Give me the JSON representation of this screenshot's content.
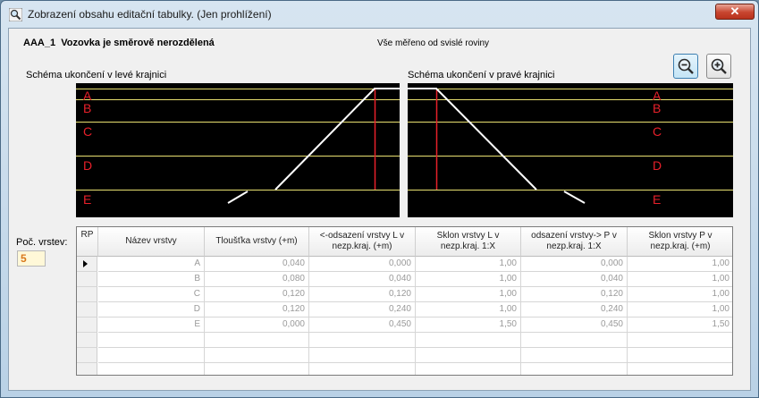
{
  "window": {
    "title": "Zobrazení obsahu editační tabulky. (Jen prohlížení)",
    "close_glyph": "✕"
  },
  "header": {
    "code": "AAA_1",
    "description": "Vozovka je směrově nerozdělená",
    "info": "Vše měřeno od svislé roviny"
  },
  "zoom": {
    "zoom_out_icon": "zoom-out-icon",
    "zoom_in_icon": "zoom-in-icon"
  },
  "schema_left": {
    "label": "Schéma ukončení v levé krajnici"
  },
  "schema_right": {
    "label": "Schéma ukončení v pravé krajnici"
  },
  "layer_letters": [
    "A",
    "B",
    "C",
    "D",
    "E"
  ],
  "colors": {
    "schema_background": "#000000",
    "layer_line": "#e8e070",
    "letter": "#e8202a",
    "slope_line": "#ffffff",
    "edge_line": "#e8202a"
  },
  "count": {
    "label": "Poč. vrstev:",
    "value": "5"
  },
  "grid": {
    "rp_header": "RP",
    "columns": [
      "Název vrstvy",
      "Tloušťka vrstvy (+m)",
      "<-odsazení vrstvy L v nezp.kraj. (+m)",
      "Sklon vrstvy L v nezp.kraj. 1:X",
      "odsazení vrstvy-> P v nezp.kraj. 1:X",
      "Sklon vrstvy P v nezp.kraj. (+m)"
    ],
    "rows": [
      [
        "A",
        "0,040",
        "0,000",
        "1,00",
        "0,000",
        "1,00"
      ],
      [
        "B",
        "0,080",
        "0,040",
        "1,00",
        "0,040",
        "1,00"
      ],
      [
        "C",
        "0,120",
        "0,120",
        "1,00",
        "0,120",
        "1,00"
      ],
      [
        "D",
        "0,120",
        "0,240",
        "1,00",
        "0,240",
        "1,00"
      ],
      [
        "E",
        "0,000",
        "0,450",
        "1,50",
        "0,450",
        "1,50"
      ]
    ]
  }
}
